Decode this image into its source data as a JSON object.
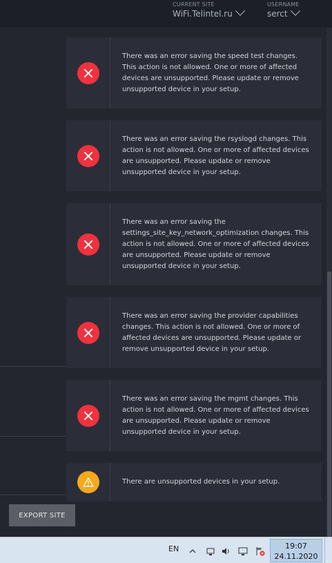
{
  "header": {
    "current_site_label": "CURRENT SITE",
    "current_site_value": "WiFi.Telintel.ru",
    "username_label": "USERNAME",
    "username_value": "serct"
  },
  "notifications": [
    {
      "type": "error",
      "icon": "error-icon",
      "text": "There was an error saving the speed test changes. This action is not allowed. One or more of affected devices are unsupported. Please update or remove unsupported device in your setup."
    },
    {
      "type": "error",
      "icon": "error-icon",
      "text": "There was an error saving the rsyslogd changes. This action is not allowed. One or more of affected devices are unsupported. Please update or remove unsupported device in your setup."
    },
    {
      "type": "error",
      "icon": "error-icon",
      "text": "There was an error saving the settings_site_key_network_optimization changes. This action is not allowed. One or more of affected devices are unsupported. Please update or remove unsupported device in your setup."
    },
    {
      "type": "error",
      "icon": "error-icon",
      "text": "There was an error saving the provider capabilities changes. This action is not allowed. One or more of affected devices are unsupported. Please update or remove unsupported device in your setup."
    },
    {
      "type": "error",
      "icon": "error-icon",
      "text": "There was an error saving the mgmt changes. This action is not allowed. One or more of affected devices are unsupported. Please update or remove unsupported device in your setup."
    },
    {
      "type": "warning",
      "icon": "warning-icon",
      "text": "There are unsupported devices in your setup."
    }
  ],
  "footer": {
    "export_label": "EXPORT SITE"
  },
  "taskbar": {
    "language": "EN",
    "time": "19:07",
    "date": "24.11.2020"
  },
  "colors": {
    "error": "#f0323e",
    "warning": "#f5a91c",
    "panel": "#2b2e39"
  }
}
